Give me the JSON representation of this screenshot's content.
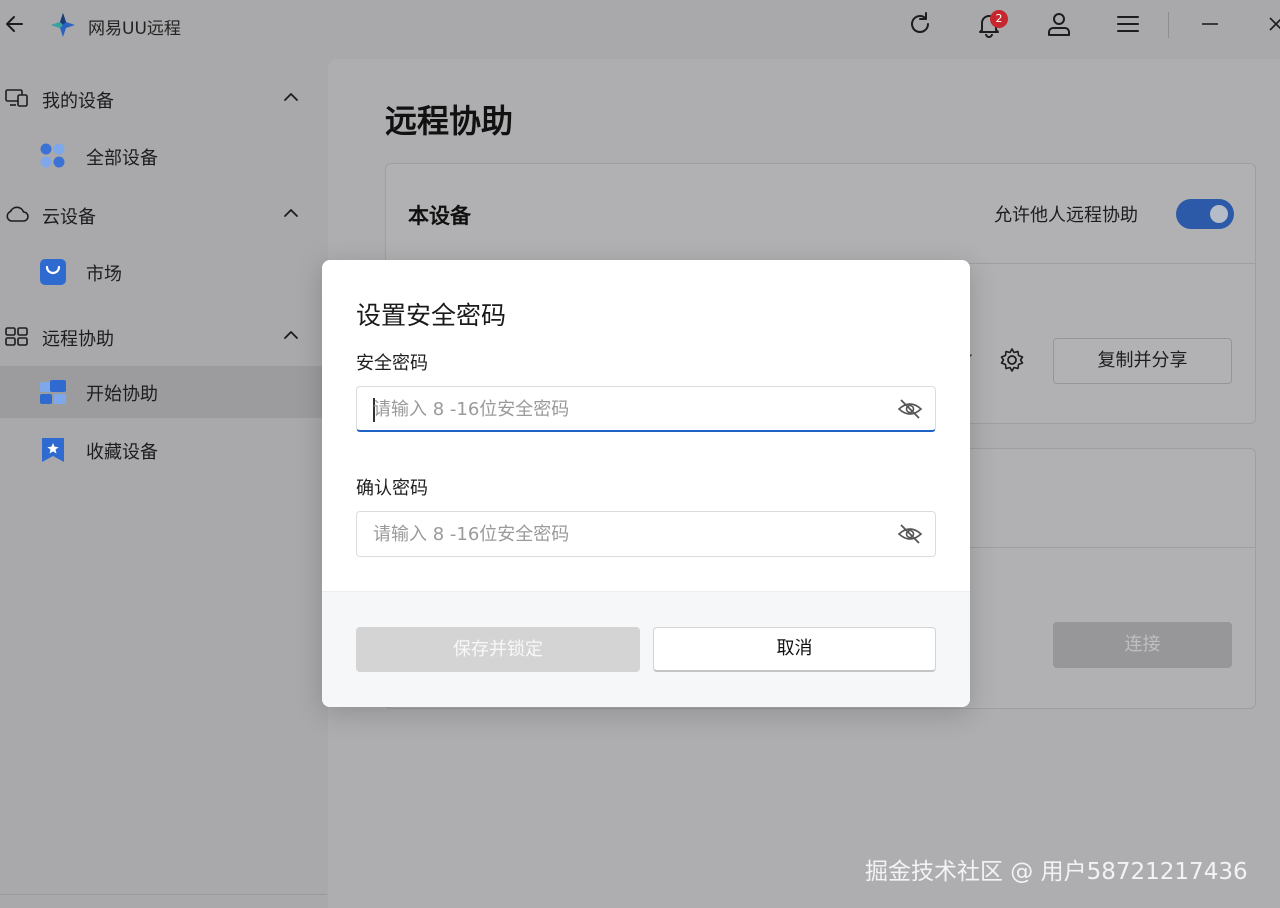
{
  "app": {
    "title": "网易UU远程",
    "notification_count": "2"
  },
  "sidebar": {
    "groups": [
      {
        "label": "我的设备",
        "items": [
          {
            "label": "全部设备"
          }
        ]
      },
      {
        "label": "云设备",
        "items": [
          {
            "label": "市场"
          }
        ]
      },
      {
        "label": "远程协助",
        "items": [
          {
            "label": "开始协助",
            "active": true
          },
          {
            "label": "收藏设备"
          }
        ]
      }
    ]
  },
  "main": {
    "title": "远程协助",
    "device_card": {
      "title": "本设备",
      "allow_label": "允许他人远程协助",
      "allow_enabled": true,
      "copy_button": "复制并分享"
    },
    "connect_button": "连接"
  },
  "dialog": {
    "title": "设置安全密码",
    "password_label": "安全密码",
    "password_placeholder": "请输入 8 -16位安全密码",
    "confirm_label": "确认密码",
    "confirm_placeholder": "请输入 8 -16位安全密码",
    "save_button": "保存并锁定",
    "cancel_button": "取消"
  },
  "watermark": "掘金技术社区 @ 用户58721217436",
  "colors": {
    "accent": "#1f63c6",
    "toggle_on": "#2d5aa8",
    "badge": "#c6262e",
    "overlay_bg": "#a9a9ab"
  }
}
